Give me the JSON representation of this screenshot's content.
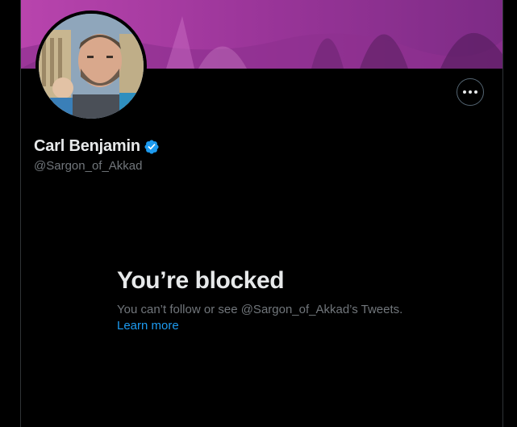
{
  "profile": {
    "display_name": "Carl Benjamin",
    "handle": "@Sargon_of_Akkad",
    "verified": true,
    "verified_icon": "verified-badge-icon",
    "more_icon": "more-options-icon"
  },
  "blocked_notice": {
    "title": "You’re blocked",
    "message": "You can’t follow or see @Sargon_of_Akkad’s Tweets.",
    "link_label": "Learn more"
  },
  "colors": {
    "background": "#000000",
    "banner": "#a63aa3",
    "primary_text": "#e7e9ea",
    "secondary_text": "#71767b",
    "link": "#1d9bf0",
    "verified": "#1d9bf0"
  }
}
